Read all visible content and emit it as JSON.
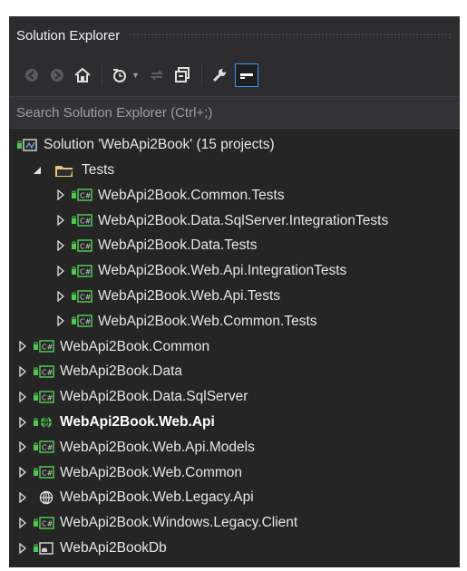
{
  "panel": {
    "title": "Solution Explorer"
  },
  "toolbar": {
    "buttons": [
      "back-icon",
      "forward-icon",
      "home-icon",
      "history-icon",
      "sync-icon",
      "collapse-all-icon",
      "properties-wrench-icon",
      "preview-icon"
    ]
  },
  "search": {
    "placeholder": "Search Solution Explorer (Ctrl+;)"
  },
  "tree": {
    "solution": "Solution 'WebApi2Book' (15 projects)",
    "folder": "Tests",
    "folder_children": [
      "WebApi2Book.Common.Tests",
      "WebApi2Book.Data.SqlServer.IntegrationTests",
      "WebApi2Book.Data.Tests",
      "WebApi2Book.Web.Api.IntegrationTests",
      "WebApi2Book.Web.Api.Tests",
      "WebApi2Book.Web.Common.Tests"
    ],
    "projects": [
      "WebApi2Book.Common",
      "WebApi2Book.Data",
      "WebApi2Book.Data.SqlServer",
      "WebApi2Book.Web.Api",
      "WebApi2Book.Web.Api.Models",
      "WebApi2Book.Web.Common",
      "WebApi2Book.Web.Legacy.Api",
      "WebApi2Book.Windows.Legacy.Client",
      "WebApi2BookDb"
    ]
  },
  "colors": {
    "background": "#252526",
    "accent": "#3399ff",
    "csharp_icon": "#4ec94e",
    "folder_icon": "#e8c27a"
  }
}
